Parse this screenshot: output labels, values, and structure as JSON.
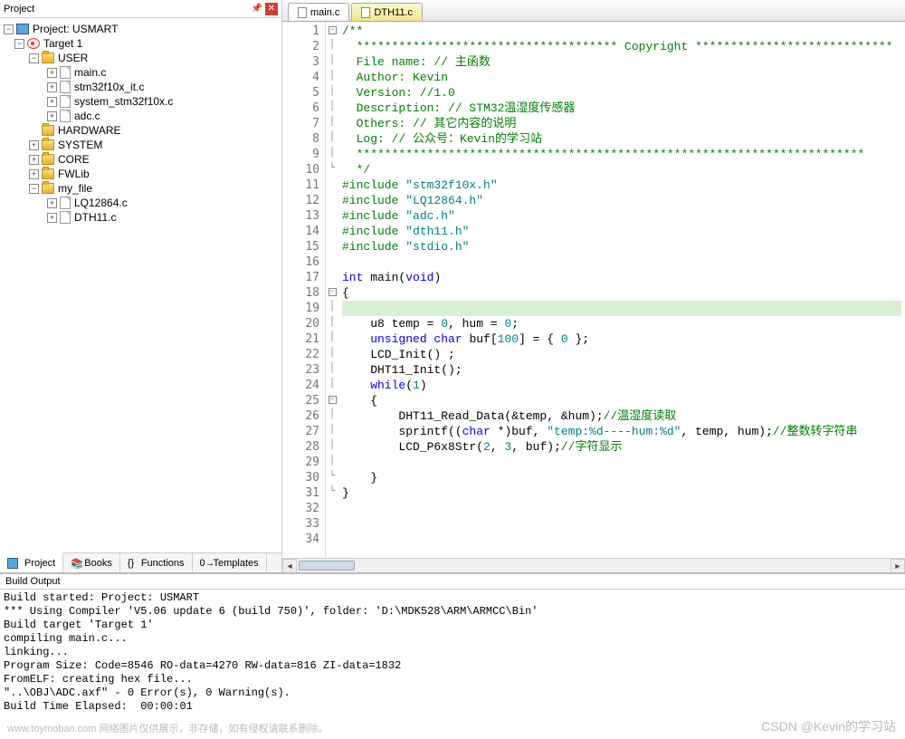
{
  "leftPanel": {
    "title": "Project",
    "tree": {
      "project": "Project: USMART",
      "target": "Target 1",
      "folders": {
        "user": "USER",
        "user_files": [
          "main.c",
          "stm32f10x_it.c",
          "system_stm32f10x.c",
          "adc.c"
        ],
        "hardware": "HARDWARE",
        "system": "SYSTEM",
        "core": "CORE",
        "fwlib": "FWLib",
        "my_file": "my_file",
        "my_file_files": [
          "LQ12864.c",
          "DTH11.c"
        ]
      }
    },
    "bottomTabs": [
      "Project",
      "Books",
      "Functions",
      "Templates"
    ]
  },
  "editor": {
    "tabs": [
      {
        "name": "main.c",
        "active": true
      },
      {
        "name": "DTH11.c",
        "active": false
      }
    ],
    "lines": [
      {
        "n": 1,
        "fold": "-",
        "raw": "/**"
      },
      {
        "n": 2,
        "fold": "|",
        "raw": "  ************************************* Copyright ****************************"
      },
      {
        "n": 3,
        "fold": "|",
        "raw": "  File name: // 主函数"
      },
      {
        "n": 4,
        "fold": "|",
        "raw": "  Author: Kevin"
      },
      {
        "n": 5,
        "fold": "|",
        "raw": "  Version: //1.0"
      },
      {
        "n": 6,
        "fold": "|",
        "raw": "  Description: // STM32温湿度传感器"
      },
      {
        "n": 7,
        "fold": "|",
        "raw": "  Others: // 其它内容的说明"
      },
      {
        "n": 8,
        "fold": "|",
        "raw": "  Log: // 公众号：Kevin的学习站"
      },
      {
        "n": 9,
        "fold": "|",
        "raw": "  ************************************************************************"
      },
      {
        "n": 10,
        "fold": "L",
        "raw": "  */"
      },
      {
        "n": 11,
        "fold": "",
        "pre": "#include ",
        "str": "\"stm32f10x.h\""
      },
      {
        "n": 12,
        "fold": "",
        "pre": "#include ",
        "str": "\"LQ12864.h\""
      },
      {
        "n": 13,
        "fold": "",
        "pre": "#include ",
        "str": "\"adc.h\""
      },
      {
        "n": 14,
        "fold": "",
        "pre": "#include ",
        "str": "\"dth11.h\""
      },
      {
        "n": 15,
        "fold": "",
        "pre": "#include ",
        "str": "\"stdio.h\""
      },
      {
        "n": 16,
        "fold": "",
        "raw": ""
      },
      {
        "n": 17,
        "fold": "",
        "kw": "int ",
        "fn": "main(",
        "kw2": "void",
        "post": ")"
      },
      {
        "n": 18,
        "fold": "-",
        "raw": "{"
      },
      {
        "n": 19,
        "fold": "|",
        "hl": true,
        "raw": ""
      },
      {
        "n": 20,
        "fold": "|",
        "body": "    u8 temp = ",
        "num": "0",
        "mid": ", hum = ",
        "num2": "0",
        "end": ";"
      },
      {
        "n": 21,
        "fold": "|",
        "kw": "    unsigned char ",
        "body": "buf[",
        "num": "100",
        "mid": "] = { ",
        "num2": "0",
        "end": " };"
      },
      {
        "n": 22,
        "fold": "|",
        "raw": "    LCD_Init() ;"
      },
      {
        "n": 23,
        "fold": "|",
        "raw": "    DHT11_Init();"
      },
      {
        "n": 24,
        "fold": "|",
        "kw": "    while",
        "body": "(",
        "num": "1",
        "end": ")"
      },
      {
        "n": 25,
        "fold": "-",
        "raw": "    {"
      },
      {
        "n": 26,
        "fold": "|",
        "body": "        DHT11_Read_Data(&temp, &hum);",
        "cmt": "//温湿度读取"
      },
      {
        "n": 27,
        "fold": "|",
        "body": "        sprintf((",
        "kw": "char ",
        "mid": "*)buf, ",
        "str": "\"temp:%d----hum:%d\"",
        "end": ", temp, hum);",
        "cmt": "//整数转字符串"
      },
      {
        "n": 28,
        "fold": "|",
        "body": "        LCD_P6x8Str(",
        "num": "2",
        "mid": ", ",
        "num2": "3",
        "end": ", buf);",
        "cmt": "//字符显示"
      },
      {
        "n": 29,
        "fold": "|",
        "raw": ""
      },
      {
        "n": 30,
        "fold": "L",
        "raw": "    }"
      },
      {
        "n": 31,
        "fold": "L",
        "raw": "}"
      },
      {
        "n": 32,
        "fold": "",
        "raw": ""
      },
      {
        "n": 33,
        "fold": "",
        "raw": ""
      },
      {
        "n": 34,
        "fold": "",
        "raw": ""
      }
    ]
  },
  "buildOutput": {
    "title": "Build Output",
    "lines": [
      "Build started: Project: USMART",
      "*** Using Compiler 'V5.06 update 6 (build 750)', folder: 'D:\\MDK528\\ARM\\ARMCC\\Bin'",
      "Build target 'Target 1'",
      "compiling main.c...",
      "linking...",
      "Program Size: Code=8546 RO-data=4270 RW-data=816 ZI-data=1832",
      "FromELF: creating hex file...",
      "\"..\\OBJ\\ADC.axf\" - 0 Error(s), 0 Warning(s).",
      "Build Time Elapsed:  00:00:01"
    ]
  },
  "watermark1": "www.toymoban.com 网络图片仅供展示，非存储，如有侵权请联系删除。",
  "watermark2": "CSDN @Kevin的学习站"
}
